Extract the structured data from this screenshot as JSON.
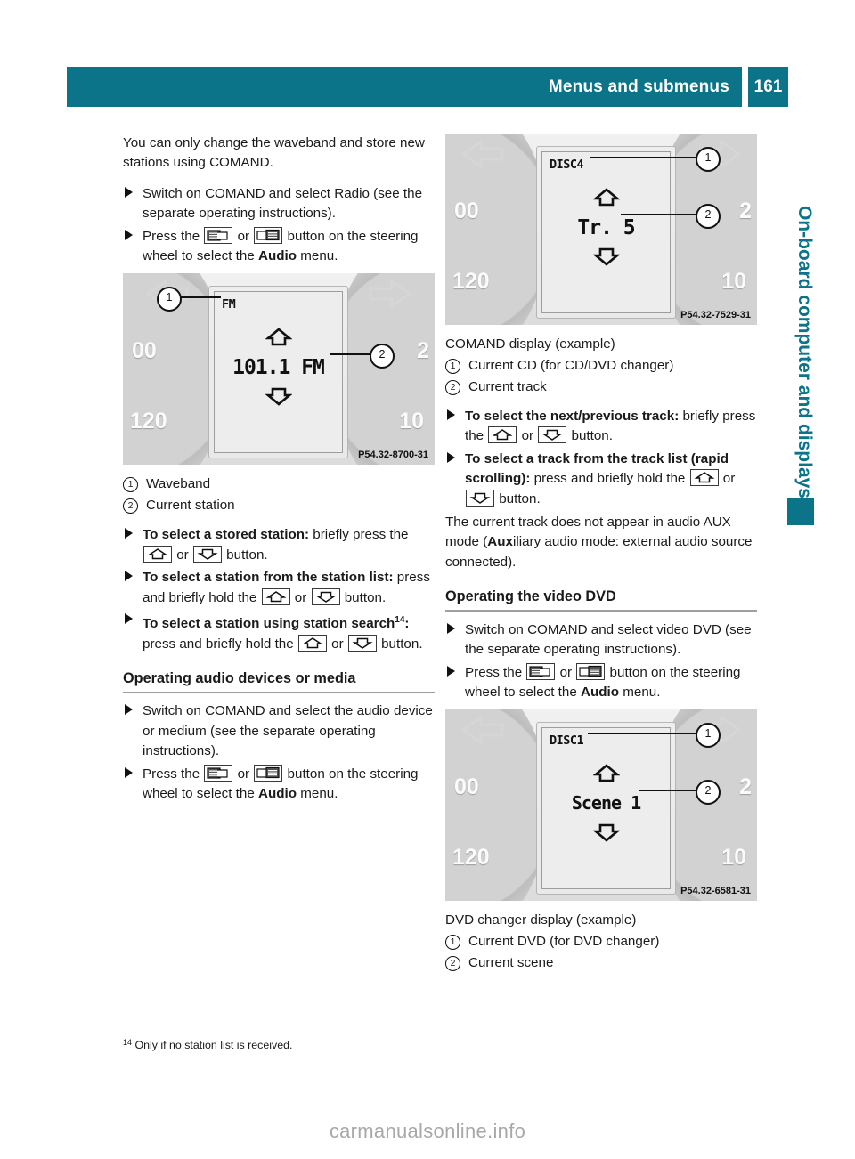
{
  "header": {
    "title": "Menus and submenus",
    "page_number": "161"
  },
  "side_tab": {
    "label": "On-board computer and displays"
  },
  "left_column": {
    "intro": "You can only change the waveband and store new stations using COMAND.",
    "steps": [
      "Switch on COMAND and select Radio (see the separate operating instructions).",
      "Press the ❑ or ❐ button on the steering wheel to select the Audio menu."
    ],
    "figure": {
      "screen_label": "FM",
      "screen_value": "101.1 FM",
      "left_dial_text": "00",
      "left_dial_text2": "120",
      "right_dial_text": "2",
      "right_dial_text2": "10",
      "code": "P54.32-8700-31",
      "callout_1": "1",
      "callout_2": "2"
    },
    "legend": [
      {
        "num": "1",
        "text": "Waveband"
      },
      {
        "num": "2",
        "text": "Current station"
      }
    ],
    "instructions": [
      {
        "bold": "To select a stored station:",
        "rest": " briefly press the △ or ▽ button."
      },
      {
        "bold": "To select a station from the station list:",
        "rest": " press and briefly hold the △ or ▽ button."
      },
      {
        "bold": "To select a station using station search",
        "sup": "14",
        "rest": ": press and briefly hold the △ or ▽ button."
      }
    ],
    "section_heading": "Operating audio devices or media",
    "section_steps": [
      "Switch on COMAND and select the audio device or medium (see the separate operating instructions).",
      "Press the ❑ or ❐ button on the steering wheel to select the Audio menu."
    ]
  },
  "right_column": {
    "figure_cd": {
      "screen_label": "DISC4",
      "screen_value": "Tr. 5",
      "left_dial_text": "00",
      "left_dial_text2": "120",
      "right_dial_text": "2",
      "right_dial_text2": "10",
      "code": "P54.32-7529-31",
      "callout_1": "1",
      "callout_2": "2"
    },
    "caption_cd": "COMAND display (example)",
    "legend_cd": [
      {
        "num": "1",
        "text": "Current CD (for CD/DVD changer)"
      },
      {
        "num": "2",
        "text": "Current track"
      }
    ],
    "instructions_cd": [
      {
        "bold": "To select the next/previous track:",
        "rest": " briefly press the △ or ▽ button."
      },
      {
        "bold": "To select a track from the track list (rapid scrolling):",
        "rest": " press and briefly hold the △ or ▽ button."
      }
    ],
    "note": "The current track does not appear in audio AUX mode (Auxiliary audio mode: external audio source connected).",
    "note_bold": "Aux",
    "section_heading": "Operating the video DVD",
    "section_steps": [
      "Switch on COMAND and select video DVD (see the separate operating instructions).",
      "Press the ❑ or ❐ button on the steering wheel to select the Audio menu."
    ],
    "figure_dvd": {
      "screen_label": "DISC1",
      "screen_value": "Scene 1",
      "left_dial_text": "00",
      "left_dial_text2": "120",
      "right_dial_text": "2",
      "right_dial_text2": "10",
      "code": "P54.32-6581-31",
      "callout_1": "1",
      "callout_2": "2"
    },
    "caption_dvd": "DVD changer display (example)",
    "legend_dvd": [
      {
        "num": "1",
        "text": "Current DVD (for DVD changer)"
      },
      {
        "num": "2",
        "text": "Current scene"
      }
    ]
  },
  "footnote": {
    "marker": "14",
    "text": " Only if no station list is received."
  },
  "watermark": "carmanualsonline.info",
  "colors": {
    "accent_teal": "#0b7489",
    "rule_gray": "#9aa0a3",
    "watermark_gray": "#a8a8a8"
  }
}
